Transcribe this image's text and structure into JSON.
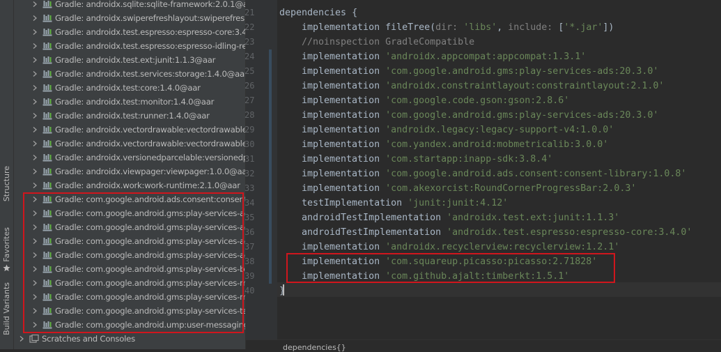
{
  "side_tabs": {
    "structure": "Structure",
    "favorites": "Favorites",
    "build_variants": "Build Variants"
  },
  "project_tree": {
    "items": [
      {
        "label": "Gradle: androidx.sqlite:sqlite-framework:2.0.1@aar",
        "highlighted": false
      },
      {
        "label": "Gradle: androidx.swiperefreshlayout:swiperefreshlayout",
        "highlighted": false
      },
      {
        "label": "Gradle: androidx.test.espresso:espresso-core:3.4.0",
        "highlighted": false
      },
      {
        "label": "Gradle: androidx.test.espresso:espresso-idling-res",
        "highlighted": false
      },
      {
        "label": "Gradle: androidx.test.ext:junit:1.1.3@aar",
        "highlighted": false
      },
      {
        "label": "Gradle: androidx.test.services:storage:1.4.0@aar",
        "highlighted": false
      },
      {
        "label": "Gradle: androidx.test:core:1.4.0@aar",
        "highlighted": false
      },
      {
        "label": "Gradle: androidx.test:monitor:1.4.0@aar",
        "highlighted": false
      },
      {
        "label": "Gradle: androidx.test:runner:1.4.0@aar",
        "highlighted": false
      },
      {
        "label": "Gradle: androidx.vectordrawable:vectordrawable:",
        "highlighted": false
      },
      {
        "label": "Gradle: androidx.vectordrawable:vectordrawable-",
        "highlighted": false
      },
      {
        "label": "Gradle: androidx.versionedparcelable:versionedpa",
        "highlighted": false
      },
      {
        "label": "Gradle: androidx.viewpager:viewpager:1.0.0@aar",
        "highlighted": false
      },
      {
        "label": "Gradle: androidx.work:work-runtime:2.1.0@aar",
        "highlighted": false
      },
      {
        "label": "Gradle: com.google.android.ads.consent:consent",
        "highlighted": true
      },
      {
        "label": "Gradle: com.google.android.gms:play-services-ac",
        "highlighted": true
      },
      {
        "label": "Gradle: com.google.android.gms:play-services-ac",
        "highlighted": true
      },
      {
        "label": "Gradle: com.google.android.gms:play-services-ac",
        "highlighted": true
      },
      {
        "label": "Gradle: com.google.android.gms:play-services-ac",
        "highlighted": true
      },
      {
        "label": "Gradle: com.google.android.gms:play-services-ba",
        "highlighted": true
      },
      {
        "label": "Gradle: com.google.android.gms:play-services-m",
        "highlighted": true
      },
      {
        "label": "Gradle: com.google.android.gms:play-services-m",
        "highlighted": true
      },
      {
        "label": "Gradle: com.google.android.gms:play-services-ta",
        "highlighted": true
      },
      {
        "label": "Gradle: com.google.android.ump:user-messaging",
        "highlighted": true
      }
    ],
    "scratches_label": "Scratches and Consoles"
  },
  "editor": {
    "lines": [
      {
        "num": "21",
        "parts": [
          {
            "t": "dependencies {",
            "c": "kw"
          }
        ],
        "indent": 0
      },
      {
        "num": "22",
        "parts": [
          {
            "t": "implementation ",
            "c": "kw"
          },
          {
            "t": "fileTree(",
            "c": "kw"
          },
          {
            "t": "dir: ",
            "c": "cmt"
          },
          {
            "t": "'libs'",
            "c": "str"
          },
          {
            "t": ", ",
            "c": "kw"
          },
          {
            "t": "include: ",
            "c": "cmt"
          },
          {
            "t": "[",
            "c": "kw"
          },
          {
            "t": "'*.jar'",
            "c": "str"
          },
          {
            "t": "])",
            "c": "kw"
          }
        ],
        "indent": 1
      },
      {
        "num": "23",
        "parts": [
          {
            "t": "//noinspection GradleCompatible",
            "c": "cmt"
          }
        ],
        "indent": 1
      },
      {
        "num": "24",
        "parts": [
          {
            "t": "implementation ",
            "c": "kw"
          },
          {
            "t": "'androidx.appcompat:appcompat:1.3.1'",
            "c": "str"
          }
        ],
        "indent": 1
      },
      {
        "num": "25",
        "parts": [
          {
            "t": "implementation ",
            "c": "kw"
          },
          {
            "t": "'com.google.android.gms:play-services-ads:20.3.0'",
            "c": "str"
          }
        ],
        "indent": 1
      },
      {
        "num": "26",
        "parts": [
          {
            "t": "implementation ",
            "c": "kw"
          },
          {
            "t": "'androidx.constraintlayout:constraintlayout:2.1.0'",
            "c": "str"
          }
        ],
        "indent": 1
      },
      {
        "num": "27",
        "parts": [
          {
            "t": "implementation ",
            "c": "kw"
          },
          {
            "t": "'com.google.code.gson:gson:2.8.6'",
            "c": "str"
          }
        ],
        "indent": 1
      },
      {
        "num": "28",
        "parts": [
          {
            "t": "implementation ",
            "c": "kw"
          },
          {
            "t": "'com.google.android.gms:play-services-ads:20.3.0'",
            "c": "str"
          }
        ],
        "indent": 1
      },
      {
        "num": "29",
        "parts": [
          {
            "t": "implementation ",
            "c": "kw"
          },
          {
            "t": "'androidx.legacy:legacy-support-v4:1.0.0'",
            "c": "str"
          }
        ],
        "indent": 1
      },
      {
        "num": "30",
        "parts": [
          {
            "t": "implementation ",
            "c": "kw"
          },
          {
            "t": "'com.yandex.android:mobmetricalib:3.0.0'",
            "c": "str"
          }
        ],
        "indent": 1
      },
      {
        "num": "31",
        "parts": [
          {
            "t": "implementation ",
            "c": "kw"
          },
          {
            "t": "'com.startapp:inapp-sdk:3.8.4'",
            "c": "str"
          }
        ],
        "indent": 1
      },
      {
        "num": "32",
        "parts": [
          {
            "t": "implementation ",
            "c": "kw"
          },
          {
            "t": "'com.google.android.ads.consent:consent-library:1.0.8'",
            "c": "str"
          }
        ],
        "indent": 1
      },
      {
        "num": "33",
        "parts": [
          {
            "t": "implementation ",
            "c": "kw"
          },
          {
            "t": "'com.akexorcist:RoundCornerProgressBar:2.0.3'",
            "c": "str"
          }
        ],
        "indent": 1
      },
      {
        "num": "34",
        "parts": [
          {
            "t": "testImplementation ",
            "c": "kw"
          },
          {
            "t": "'junit:junit:4.12'",
            "c": "str"
          }
        ],
        "indent": 1
      },
      {
        "num": "35",
        "parts": [
          {
            "t": "androidTestImplementation ",
            "c": "kw"
          },
          {
            "t": "'androidx.test.ext:junit:1.1.3'",
            "c": "str"
          }
        ],
        "indent": 1
      },
      {
        "num": "36",
        "parts": [
          {
            "t": "androidTestImplementation ",
            "c": "kw"
          },
          {
            "t": "'androidx.test.espresso:espresso-core:3.4.0'",
            "c": "str"
          }
        ],
        "indent": 1
      },
      {
        "num": "37",
        "parts": [
          {
            "t": "implementation ",
            "c": "kw"
          },
          {
            "t": "'androidx.recyclerview:recyclerview:1.2.1'",
            "c": "str"
          }
        ],
        "indent": 1
      },
      {
        "num": "38",
        "parts": [
          {
            "t": "implementation ",
            "c": "kw"
          },
          {
            "t": "'com.squareup.picasso:picasso:2.71828'",
            "c": "str"
          }
        ],
        "indent": 1
      },
      {
        "num": "39",
        "parts": [
          {
            "t": "implementation ",
            "c": "kw"
          },
          {
            "t": "'com.github.ajalt:timberkt:1.5.1'",
            "c": "str"
          }
        ],
        "indent": 1
      },
      {
        "num": "40",
        "parts": [
          {
            "t": "}",
            "c": "kw"
          }
        ],
        "indent": 0
      }
    ],
    "breadcrumb": "dependencies{}"
  },
  "colors": {
    "highlight_border": "#d0161d",
    "string": "#6a8759",
    "keyword": "#a9b7c6",
    "comment": "#808080",
    "panel_bg": "#3c3f41",
    "editor_bg": "#2b2b2b"
  },
  "icons": {
    "chevron": "chevron-right-icon",
    "library": "library-icon",
    "scratches": "scratches-icon",
    "star": "star-icon"
  }
}
